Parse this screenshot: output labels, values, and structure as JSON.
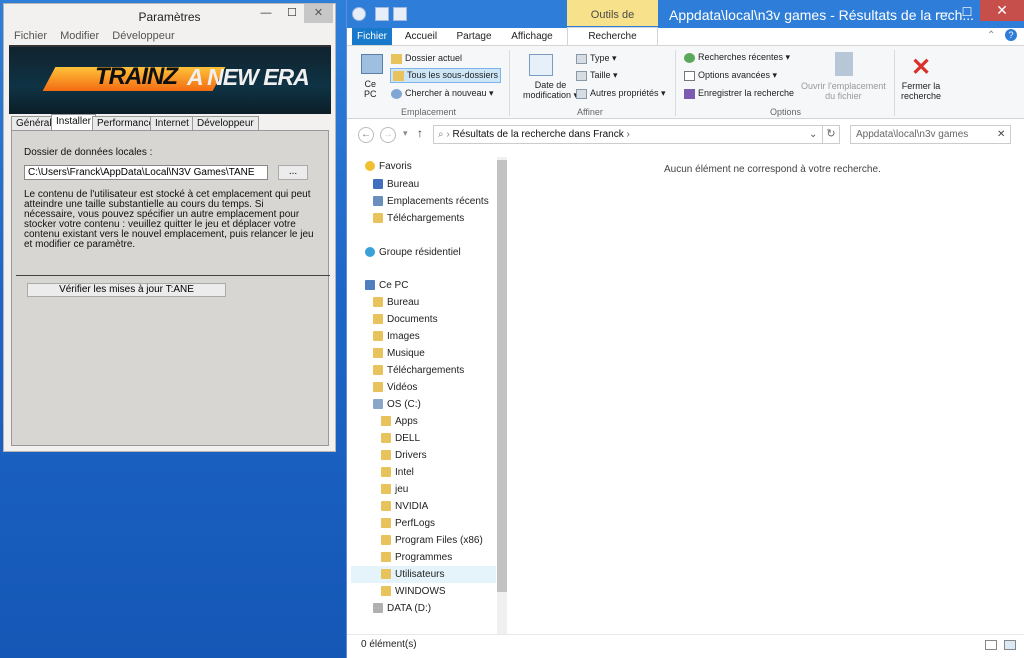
{
  "settings": {
    "title": "Paramètres",
    "minimize": "—",
    "maximize": "☐",
    "close": "✕",
    "menu": [
      "Fichier",
      "Modifier",
      "Développeur"
    ],
    "logo_left": "TRAINZ",
    "logo_right": "A NEW ERA",
    "tabs": [
      "Général",
      "Installer",
      "Performance",
      "Internet",
      "Développeur"
    ],
    "active_tab": "Installer",
    "local_data_label": "Dossier de données locales :",
    "local_data_path": "C:\\Users\\Franck\\AppData\\Local\\N3V Games\\TANE",
    "browse_label": "...",
    "description": "Le contenu de l'utilisateur est stocké à cet emplacement qui peut atteindre une taille substantielle au cours du temps. Si nécessaire, vous pouvez spécifier un autre emplacement pour stocker votre contenu : veuillez quitter le jeu et déplacer votre contenu existant vers le nouvel emplacement, puis relancer le jeu et modifier ce paramètre.",
    "update_button": "Vérifier les mises à jour T:ANE"
  },
  "explorer": {
    "title": "Appdata\\local\\n3v games - Résultats de la rech...",
    "context_tab": "Outils de recherche",
    "minimize": "—",
    "maximize": "☐",
    "close": "✕",
    "ribbon_tabs": [
      "Fichier",
      "Accueil",
      "Partage",
      "Affichage",
      "Recherche"
    ],
    "active_ribbon_tab": "Recherche",
    "ribbon": {
      "ce_pc": "Ce\nPC",
      "dossier_actuel": "Dossier actuel",
      "tous_sous_dossiers": "Tous les sous-dossiers",
      "chercher_nouveau": "Chercher à nouveau ▾",
      "group_emplacement": "Emplacement",
      "date_modif": "Date de\nmodification ▾",
      "type": "Type ▾",
      "taille": "Taille ▾",
      "autres_proprietes": "Autres propriétés ▾",
      "group_affiner": "Affiner",
      "recherches_recentes": "Recherches récentes ▾",
      "options_avancees": "Options avancées ▾",
      "enregistrer": "Enregistrer la recherche",
      "ouvrir_emplacement": "Ouvrir l'emplacement\ndu fichier",
      "group_options": "Options",
      "fermer": "Fermer la\nrecherche"
    },
    "address": "Résultats de la recherche dans Franck",
    "search_box": "Appdata\\local\\n3v games",
    "nav": {
      "favoris": "Favoris",
      "fav_items": [
        "Bureau",
        "Emplacements récents",
        "Téléchargements"
      ],
      "groupe": "Groupe résidentiel",
      "ce_pc": "Ce PC",
      "pc_items": [
        "Bureau",
        "Documents",
        "Images",
        "Musique",
        "Téléchargements",
        "Vidéos"
      ],
      "os_drive": "OS (C:)",
      "os_items": [
        "Apps",
        "DELL",
        "Drivers",
        "Intel",
        "jeu",
        "NVIDIA",
        "PerfLogs",
        "Program Files (x86)",
        "Programmes",
        "Utilisateurs",
        "WINDOWS"
      ],
      "data_drive": "DATA (D:)"
    },
    "no_results": "Aucun élément ne correspond à votre recherche.",
    "status": "0 élément(s)",
    "colors": {
      "titlebar": "#2e7dd8",
      "fichier_tab": "#1979ca",
      "context": "#f7e28b",
      "folder": "#e8c25a"
    }
  }
}
